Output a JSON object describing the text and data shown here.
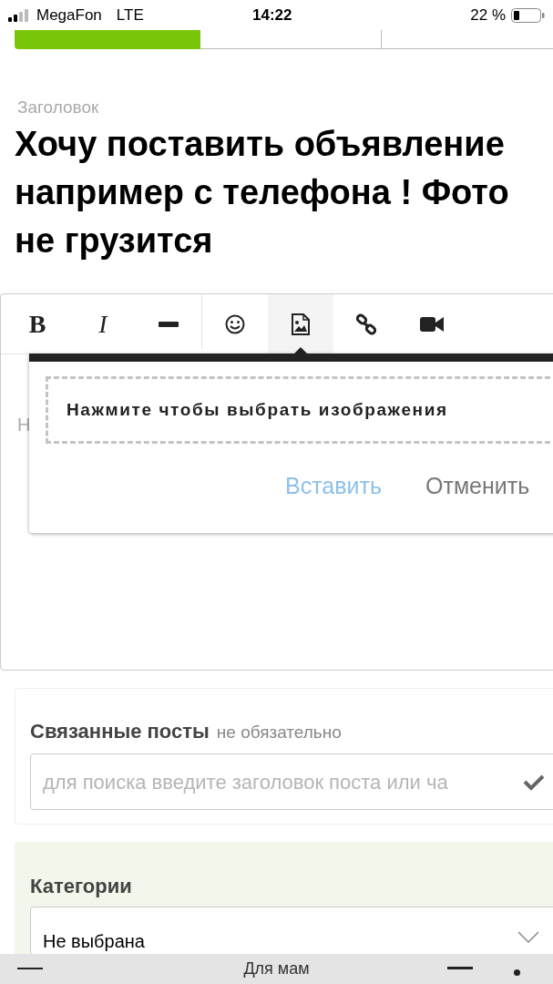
{
  "status_bar": {
    "carrier": "MegaFon",
    "network": "LTE",
    "time": "14:22",
    "battery": "22 %"
  },
  "tabs": [
    {
      "selected": true
    },
    {
      "selected": false
    },
    {
      "selected": false
    }
  ],
  "title_field": {
    "label": "Заголовок",
    "value": "Хочу поставить объявление например с телефона ! Фото не грузится"
  },
  "editor": {
    "toolbar_groups": [
      {
        "tools": [
          {
            "kind": "bold",
            "label": "B",
            "selected": false
          },
          {
            "kind": "italic",
            "label": "I",
            "selected": false
          },
          {
            "kind": "hr",
            "selected": false
          }
        ]
      },
      {
        "tools": [
          {
            "kind": "emoji",
            "selected": false
          },
          {
            "kind": "image",
            "selected": true
          },
          {
            "kind": "link",
            "selected": false
          },
          {
            "kind": "video",
            "selected": false
          }
        ]
      }
    ],
    "placeholder": "Н",
    "image_dialog": {
      "prompt": "Нажмите чтобы выбрать изображения",
      "insert": "Вставить",
      "cancel": "Отменить"
    }
  },
  "related_posts": {
    "title": "Связанные посты",
    "hint": "не обязательно",
    "placeholder": "для поиска введите заголовок поста или ча"
  },
  "categories": {
    "title": "Категории",
    "value": "Не выбрана"
  },
  "browser_bar": {
    "title": "Для мам"
  }
}
